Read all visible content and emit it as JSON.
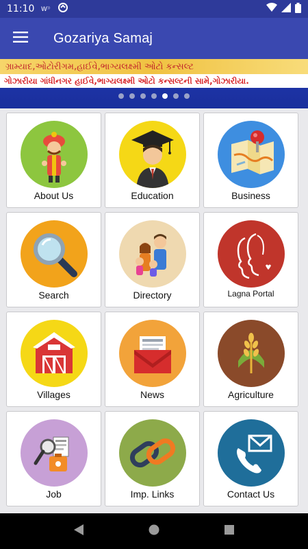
{
  "status_bar": {
    "time": "11:10",
    "icons": [
      "wifi-calling-icon",
      "sync-icon",
      "wifi-icon",
      "signal-icon",
      "battery-icon"
    ]
  },
  "app_bar": {
    "title": "Gozariya Samaj",
    "menu_icon": "hamburger-menu-icon"
  },
  "banner": {
    "top_text": "ગ્રામ્યાદ,ઓટોરીગમ,હાઈવે,ભાગ્યલક્ષ્મી ઓટો કન્સલ્ટ",
    "line_text": "ગોઝારીયા ગાંધીનગર હાઈવે,ભાગ્યલક્ષ્મી ઓટો કન્સલ્ટની સામે,ગોઝારીયા.",
    "slide_count": 7,
    "active_slide": 5
  },
  "tiles": [
    {
      "label": "About Us",
      "icon": "man-with-turban-icon",
      "color": "#8dc63f"
    },
    {
      "label": "Education",
      "icon": "graduate-icon",
      "color": "#f5d816"
    },
    {
      "label": "Business",
      "icon": "map-pin-icon",
      "color": "#3e8ee0"
    },
    {
      "label": "Search",
      "icon": "magnifier-icon",
      "color": "#f2a31b"
    },
    {
      "label": "Directory",
      "icon": "family-icon",
      "color": "#efd9b0"
    },
    {
      "label": "Lagna Portal",
      "icon": "couple-faces-icon",
      "color": "#c0352b"
    },
    {
      "label": "Villages",
      "icon": "barn-icon",
      "color": "#f5d816"
    },
    {
      "label": "News",
      "icon": "envelope-newspaper-icon",
      "color": "#f2a33a"
    },
    {
      "label": "Agriculture",
      "icon": "wheat-icon",
      "color": "#8a4a2a"
    },
    {
      "label": "Job",
      "icon": "job-find-icon",
      "color": "#c7a0d6"
    },
    {
      "label": "Imp. Links",
      "icon": "chain-link-icon",
      "color": "#8daa4a"
    },
    {
      "label": "Contact Us",
      "icon": "phone-mail-icon",
      "color": "#1f6e9a"
    }
  ],
  "nav_bar": {
    "back": "back-triangle-icon",
    "home": "home-circle-icon",
    "recents": "recents-square-icon"
  }
}
